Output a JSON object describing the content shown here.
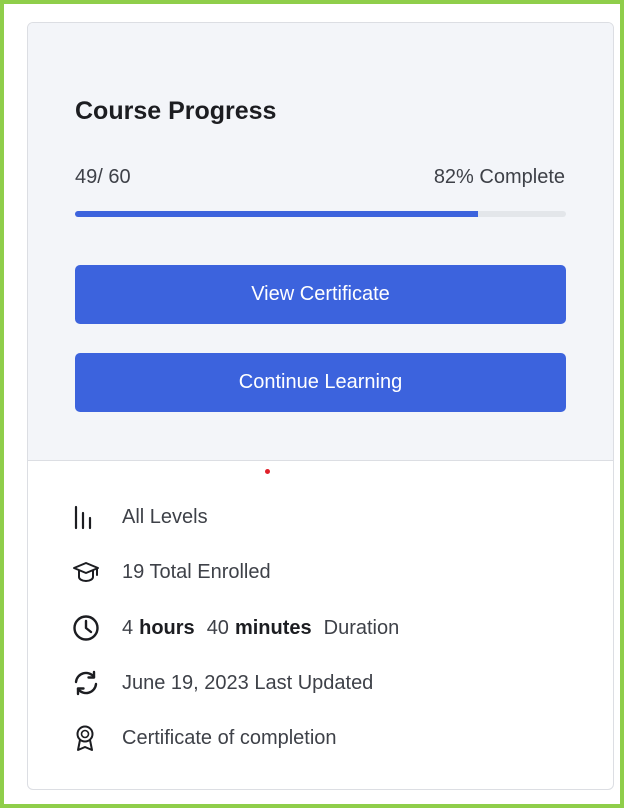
{
  "course_progress": {
    "title": "Course Progress",
    "count": "49/ 60",
    "percent_label": "82% Complete",
    "progress_fraction": 0.82,
    "buttons": {
      "view_certificate": "View Certificate",
      "continue_learning": "Continue Learning"
    }
  },
  "meta": {
    "level": {
      "icon": "bar-levels-icon",
      "label": "All Levels"
    },
    "enrolled": {
      "icon": "graduation-cap-icon",
      "label": "19 Total Enrolled"
    },
    "duration": {
      "icon": "clock-icon",
      "hours_value": "4",
      "hours_unit": "hours",
      "minutes_value": "40",
      "minutes_unit": "minutes",
      "suffix": "Duration"
    },
    "updated": {
      "icon": "refresh-icon",
      "label": "June 19, 2023 Last Updated"
    },
    "certificate": {
      "icon": "award-icon",
      "label": "Certificate of completion"
    }
  },
  "colors": {
    "accent": "#3c63dd",
    "frame": "#8fce4a",
    "panel": "#f3f5f9"
  }
}
